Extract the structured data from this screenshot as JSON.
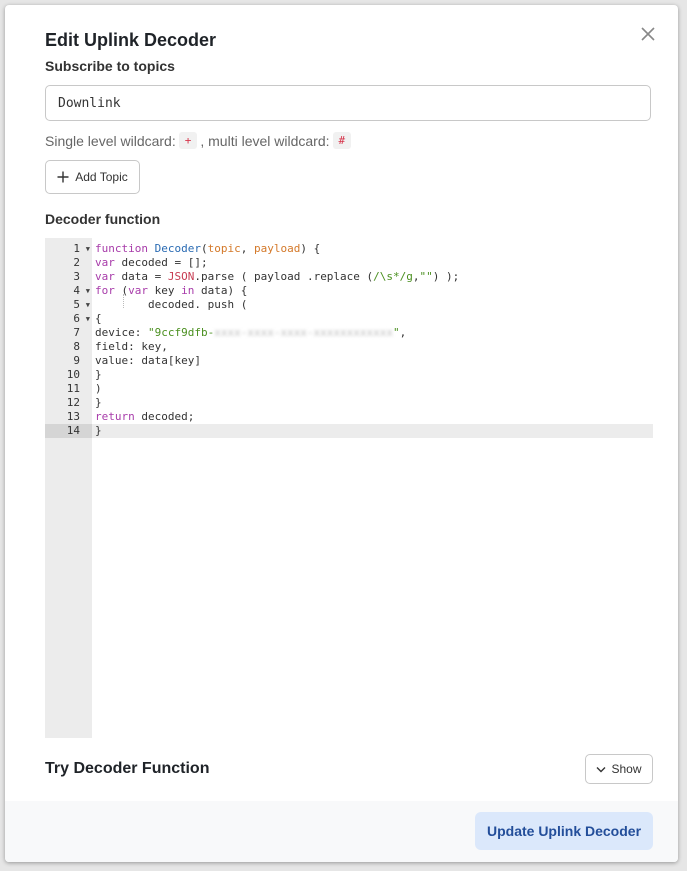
{
  "dialog": {
    "title": "Edit Uplink Decoder",
    "subscribe_label": "Subscribe to topics",
    "topic_value": "Downlink",
    "wildcard": {
      "single_text": "Single level wildcard:",
      "single_symbol": "+",
      "multi_text": ", multi level wildcard:",
      "multi_symbol": "#"
    },
    "add_topic_label": "Add Topic",
    "decoder_label": "Decoder function",
    "try_label": "Try Decoder Function",
    "show_label": "Show",
    "update_label": "Update Uplink Decoder"
  },
  "editor": {
    "line_numbers": [
      "1",
      "2",
      "3",
      "4",
      "5",
      "6",
      "7",
      "8",
      "9",
      "10",
      "11",
      "12",
      "13",
      "14"
    ],
    "active_line": 14,
    "lines": {
      "l1_kw": "function",
      "l1_fn": "Decoder",
      "l1_open": "(",
      "l1_p1": "topic",
      "l1_comma": ", ",
      "l1_p2": "payload",
      "l1_close": ") {",
      "l2_kw": "var",
      "l2_rest": " decoded = [];",
      "l3_kw": "var",
      "l3_mid": " data = ",
      "l3_json": "JSON",
      "l3_parse": ".parse ( payload .replace (",
      "l3_regex": "/\\s*/g",
      "l3_c": ",",
      "l3_str": "\"\"",
      "l3_end": ") );",
      "l4_kw": "for",
      "l4_a": " (",
      "l4_var": "var",
      "l4_b": " key ",
      "l4_in": "in",
      "l4_c": " data) {",
      "l5": "decoded. push (",
      "l6": "{",
      "l7_key": "device: ",
      "l7_str": "\"9ccf9dfb-",
      "l7_blur": "xxxx-xxxx-xxxx-xxxxxxxxxxxx",
      "l7_end_str": "\"",
      "l7_comma": ",",
      "l8": "field: key,",
      "l9": "value: data[key]",
      "l10": "}",
      "l11": ")",
      "l12": "}",
      "l13_kw": "return",
      "l13_rest": " decoded;",
      "l14": "}"
    }
  },
  "icons": {
    "close": "close-icon",
    "add": "plus-icon",
    "show": "chevron-down-icon",
    "fold": "fold-arrow-icon"
  }
}
